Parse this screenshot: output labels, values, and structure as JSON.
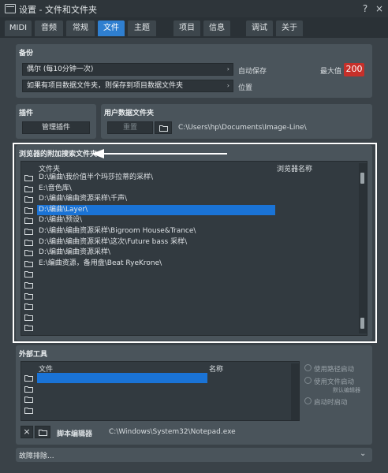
{
  "window": {
    "title": "设置 - 文件和文件夹",
    "help": "?",
    "close": "×"
  },
  "tabs": [
    {
      "label": "MIDI",
      "active": false
    },
    {
      "label": "音频",
      "active": false
    },
    {
      "label": "常规",
      "active": false
    },
    {
      "label": "文件",
      "active": true
    },
    {
      "label": "主题",
      "active": false
    },
    {
      "label": "项目",
      "active": false
    },
    {
      "label": "信息",
      "active": false
    },
    {
      "label": "调试",
      "active": false
    },
    {
      "label": "关于",
      "active": false
    }
  ],
  "backup": {
    "section_label": "备份",
    "frequency_value": "偶尔 (每10分钟一次)",
    "frequency_side_label": "自动保存",
    "location_value": "如果有项目数据文件夹，则保存到项目数据文件夹",
    "location_side_label": "位置",
    "max_label": "最大值",
    "max_value": "200"
  },
  "plugins": {
    "section_label": "插件",
    "manage_button": "管理插件"
  },
  "user_data": {
    "section_label": "用户数据文件夹",
    "reset_button": "重置",
    "path": "C:\\Users\\hp\\Documents\\Image-Line\\"
  },
  "browser_folders": {
    "section_label": "浏览器的附加搜索文件夹",
    "col_folder": "文件夹",
    "col_name": "浏览器名称",
    "rows": [
      {
        "path": "D:\\编曲\\我价值半个玛莎拉蒂的采样\\",
        "selected": false
      },
      {
        "path": "E:\\音色库\\",
        "selected": false
      },
      {
        "path": "D:\\编曲\\编曲资源采样\\千声\\",
        "selected": false
      },
      {
        "path": "D:\\编曲\\Layer\\",
        "selected": true
      },
      {
        "path": "D:\\编曲\\预设\\",
        "selected": false
      },
      {
        "path": "D:\\编曲\\编曲资源采样\\Bigroom House&Trance\\",
        "selected": false
      },
      {
        "path": "D:\\编曲\\编曲资源采样\\这次\\Future bass 采样\\",
        "selected": false
      },
      {
        "path": "D:\\编曲\\编曲资源采样\\",
        "selected": false
      },
      {
        "path": "E:\\编曲资源，备用盘\\Beat RyeKrone\\",
        "selected": false
      },
      {
        "path": "",
        "selected": false
      },
      {
        "path": "",
        "selected": false
      },
      {
        "path": "",
        "selected": false
      },
      {
        "path": "",
        "selected": false
      },
      {
        "path": "",
        "selected": false
      },
      {
        "path": "",
        "selected": false
      }
    ]
  },
  "external_tools": {
    "section_label": "外部工具",
    "col_file": "文件",
    "col_name": "名称",
    "options": [
      "使用路径启动",
      "使用文件启动",
      "启动时启动"
    ],
    "note": "默认编辑器",
    "script_editor_label": "脚本编辑器",
    "script_editor_path": "C:\\Windows\\System32\\Notepad.exe",
    "clear_icon_text": "×"
  },
  "troubleshoot": {
    "label": "故障排除..."
  },
  "colors": {
    "accent": "#2f7fd0",
    "selection": "#1a73d6",
    "max_value_bg": "#c6302a"
  }
}
